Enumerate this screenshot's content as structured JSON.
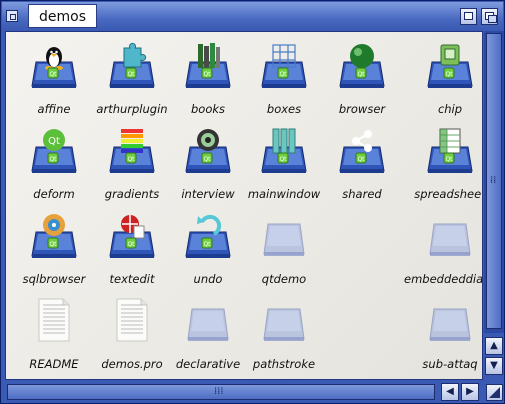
{
  "window": {
    "title": "demos"
  },
  "icons": [
    {
      "label": "affine",
      "type": "drawer",
      "emblem": "tux"
    },
    {
      "label": "arthurplugin",
      "type": "drawer",
      "emblem": "puzzle"
    },
    {
      "label": "books",
      "type": "drawer",
      "emblem": "books"
    },
    {
      "label": "boxes",
      "type": "drawer",
      "emblem": "grid"
    },
    {
      "label": "browser",
      "type": "drawer",
      "emblem": "globe"
    },
    {
      "label": "chip",
      "type": "drawer",
      "emblem": "chip"
    },
    {
      "label": "deform",
      "type": "drawer",
      "emblem": "qt"
    },
    {
      "label": "gradients",
      "type": "drawer",
      "emblem": "stripes"
    },
    {
      "label": "interview",
      "type": "drawer",
      "emblem": "eye"
    },
    {
      "label": "mainwindow",
      "type": "drawer",
      "emblem": "columns"
    },
    {
      "label": "shared",
      "type": "drawer",
      "emblem": "share"
    },
    {
      "label": "spreadsheet",
      "type": "drawer",
      "emblem": "sheet"
    },
    {
      "label": "sqlbrowser",
      "type": "drawer",
      "emblem": "disc"
    },
    {
      "label": "textedit",
      "type": "drawer",
      "emblem": "ball"
    },
    {
      "label": "undo",
      "type": "drawer",
      "emblem": "undo"
    },
    {
      "label": "qtdemo",
      "type": "ghost"
    },
    {
      "label": "embeddeddialogs",
      "type": "ghost"
    },
    {
      "label": "README",
      "type": "doc"
    },
    {
      "label": "demos.pro",
      "type": "doc"
    },
    {
      "label": "declarative",
      "type": "ghost"
    },
    {
      "label": "pathstroke",
      "type": "ghost"
    },
    {
      "label": "sub-attaq",
      "type": "ghost"
    }
  ],
  "colors": {
    "frame": "#3a5ab3",
    "content": "#efeee9",
    "drawer": "#3c62c4",
    "badge": "#5fbf3a"
  }
}
